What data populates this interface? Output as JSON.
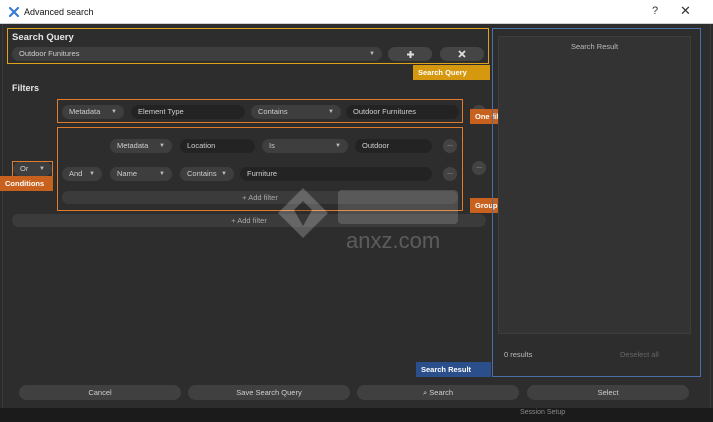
{
  "window": {
    "title": "Advanced search",
    "help_label": "?",
    "close_label": "✕"
  },
  "search_query": {
    "heading": "Search Query",
    "selected": "Outdoor Funitures",
    "add_icon": "plus-icon",
    "remove_icon": "x-icon",
    "callout": "Search Query"
  },
  "filters": {
    "heading": "Filters",
    "single": {
      "field": "Metadata",
      "element": "Element Type",
      "operator": "Contains",
      "value": "Outdoor Furnitures",
      "callout": "One filter"
    },
    "group": {
      "condition": "Or",
      "conditions_callout": "Conditions",
      "callout": "Group of filters",
      "row1": {
        "field": "Metadata",
        "element": "Location",
        "operator": "Is",
        "value": "Outdoor"
      },
      "row2": {
        "condition": "And",
        "field": "Name",
        "operator": "Contains",
        "value": "Furniture"
      },
      "add_filter_inner": "Add filter",
      "more_label": "..."
    },
    "add_filter_outer": "Add filter"
  },
  "results": {
    "header": "Search Result",
    "count": "0 results",
    "deselect": "Deselect all",
    "callout": "Search Result"
  },
  "buttons": {
    "cancel": "Cancel",
    "save": "Save Search Query",
    "search": "Search",
    "select": "Select"
  },
  "status_strip": "Session Setup",
  "watermark_text": "anxz.com",
  "colors": {
    "orange": "#e07a2c",
    "gold": "#e0a21a",
    "blue": "#2b4f8a"
  }
}
